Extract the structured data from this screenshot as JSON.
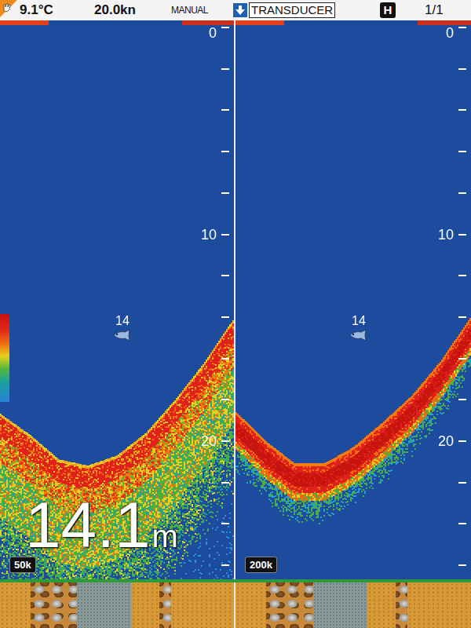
{
  "status_bar": {
    "water_temp": "9.1°C",
    "speed": "20.0kn",
    "mode": "MANUAL",
    "source": "TRANSDUCER",
    "badge": "H",
    "page": "1/1"
  },
  "depth": {
    "value": "14.1",
    "unit": "m"
  },
  "scale": {
    "ticks": [
      "0",
      "10",
      "20"
    ]
  },
  "panels": [
    {
      "frequency": "50k",
      "kind": "low",
      "fish": {
        "label": "14",
        "depth": 15.1
      },
      "bottom_profile": [
        18.7,
        19.7,
        20.9,
        21.2,
        20.7,
        19.6,
        18.0,
        16.2,
        14.1
      ],
      "seabed": [
        {
          "kind": "sand",
          "span": 0.13
        },
        {
          "kind": "rock",
          "span": 0.2
        },
        {
          "kind": "gravel",
          "span": 0.23
        },
        {
          "kind": "sand",
          "span": 0.12
        },
        {
          "kind": "rock",
          "span": 0.05
        },
        {
          "kind": "sand",
          "span": 0.27
        }
      ]
    },
    {
      "frequency": "200k",
      "kind": "high",
      "fish": {
        "label": "14",
        "depth": 15.1
      },
      "bottom_profile": [
        18.6,
        20.0,
        21.1,
        21.1,
        20.3,
        19.1,
        17.8,
        16.1,
        14.0
      ],
      "seabed": [
        {
          "kind": "sand",
          "span": 0.13
        },
        {
          "kind": "rock",
          "span": 0.2
        },
        {
          "kind": "gravel",
          "span": 0.23
        },
        {
          "kind": "sand",
          "span": 0.12
        },
        {
          "kind": "rock",
          "span": 0.05
        },
        {
          "kind": "sand",
          "span": 0.27
        }
      ]
    }
  ]
}
